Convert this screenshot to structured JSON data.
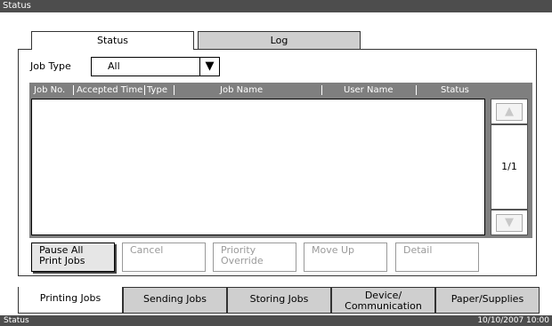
{
  "window": {
    "title": "Status"
  },
  "top_tabs": [
    {
      "label": "Status"
    },
    {
      "label": "Log"
    }
  ],
  "job_type": {
    "label": "Job Type",
    "value": "All"
  },
  "columns": [
    "Job No.",
    "Accepted Time",
    "Type",
    "Job Name",
    "User Name",
    "Status"
  ],
  "scroll": {
    "page": "1/1"
  },
  "buttons": {
    "pause_all": "Pause All\nPrint Jobs",
    "cancel": "Cancel",
    "priority_override": "Priority\nOverride",
    "move_up": "Move Up",
    "detail": "Detail"
  },
  "bottom_tabs": [
    {
      "label": "Printing Jobs"
    },
    {
      "label": "Sending Jobs"
    },
    {
      "label": "Storing Jobs"
    },
    {
      "label": "Device/\nCommunication"
    },
    {
      "label": "Paper/Supplies"
    }
  ],
  "status_bar": {
    "left": "Status",
    "datetime": "10/10/2007 10:00"
  }
}
